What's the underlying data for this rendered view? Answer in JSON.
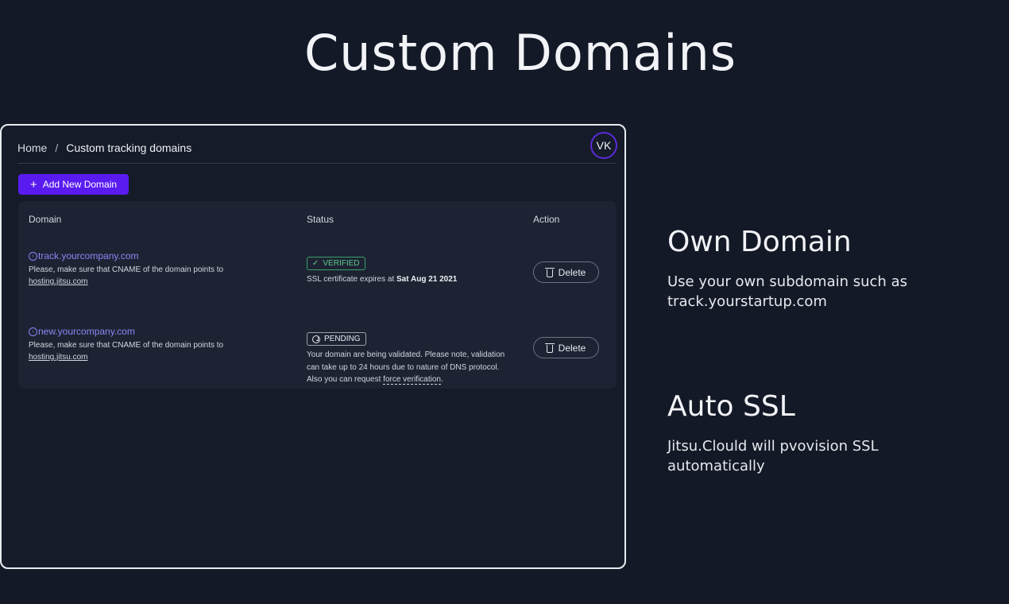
{
  "page": {
    "title": "Custom Domains"
  },
  "app": {
    "breadcrumb": {
      "home": "Home",
      "separator": "/",
      "current": "Custom tracking domains"
    },
    "avatar_initials": "VK",
    "add_button": {
      "icon": "+",
      "label": "Add New Domain"
    },
    "table": {
      "headers": {
        "domain": "Domain",
        "status": "Status",
        "action": "Action"
      },
      "rows": [
        {
          "domain": "track.yourcompany.com",
          "hint_text": "Please, make sure that CNAME of the domain points to",
          "hint_link": "hosting.jitsu.com",
          "status_badge": "VERIFIED",
          "status_line_prefix": "SSL certificate expires at ",
          "status_line_bold": "Sat Aug 21 2021",
          "action_label": "Delete"
        },
        {
          "domain": "new.yourcompany.com",
          "hint_text": "Please, make sure that CNAME of the domain points to",
          "hint_link": "hosting.jitsu.com",
          "status_badge": "PENDING",
          "status_line_1": "Your domain are being validated. Please note, validation",
          "status_line_2": "can take up to 24 hours due to nature of DNS protocol.",
          "status_line_3_prefix": "Also you can request ",
          "status_line_3_link": "force verification",
          "status_line_3_suffix": ".",
          "action_label": "Delete"
        }
      ]
    }
  },
  "features": [
    {
      "title": "Own Domain",
      "line1": "Use your own subdomain such as",
      "line2": "track.yourstartup.com"
    },
    {
      "title": "Auto SSL",
      "line1": "Jitsu.Clould will pvovision SSL",
      "line2": "automatically"
    }
  ],
  "colors": {
    "background": "#141927",
    "accent": "#5a1bf0",
    "link": "#8b87f5",
    "verified": "#5fc98d"
  }
}
